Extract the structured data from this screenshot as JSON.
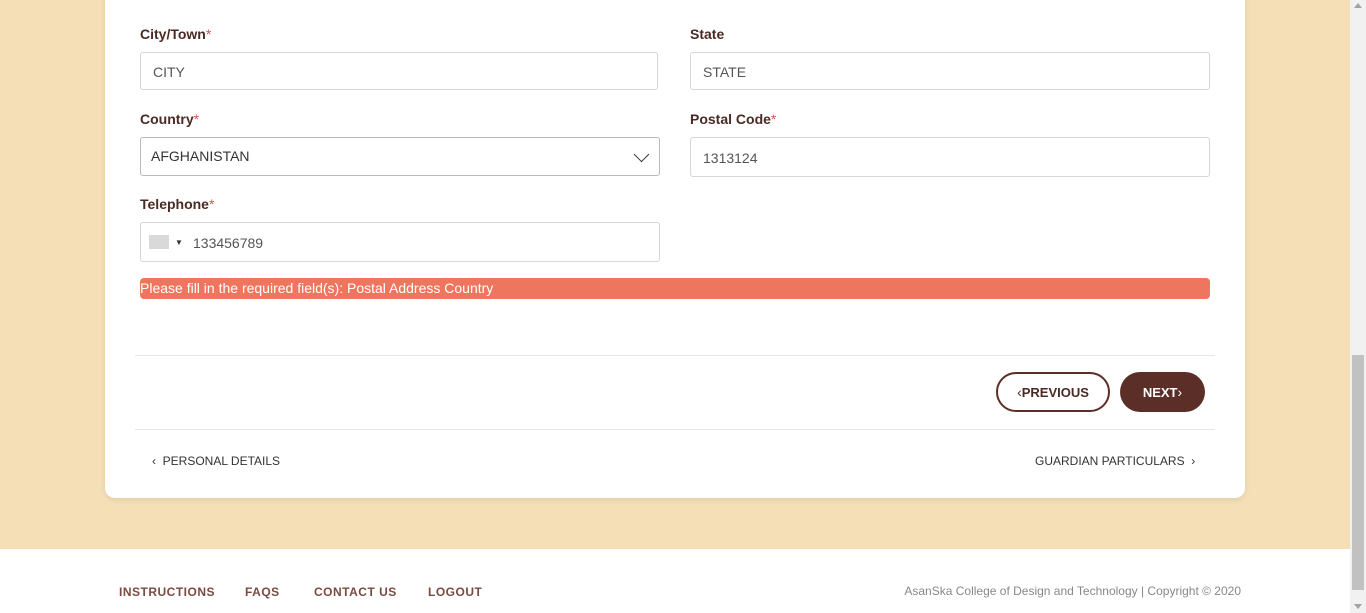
{
  "form": {
    "city": {
      "label": "City/Town",
      "required": "*",
      "placeholder": "CITY"
    },
    "state": {
      "label": "State",
      "placeholder": "STATE"
    },
    "country": {
      "label": "Country",
      "required": "*",
      "value": "AFGHANISTAN"
    },
    "postal": {
      "label": "Postal Code",
      "required": "*",
      "value": "1313124"
    },
    "telephone": {
      "label": "Telephone",
      "required": "*",
      "value": "133456789"
    },
    "error": "Please fill in the required field(s): Postal Address Country"
  },
  "buttons": {
    "previous": "PREVIOUS",
    "next": "NEXT"
  },
  "steps": {
    "prev": "PERSONAL DETAILS",
    "next": "GUARDIAN PARTICULARS"
  },
  "footer": {
    "links": [
      "INSTRUCTIONS",
      "FAQS",
      "CONTACT US",
      "LOGOUT"
    ],
    "copyright": "AsanSka College of Design and Technology | Copyright © 2020"
  },
  "colors": {
    "brand": "#5b2f28",
    "error": "#ef765e",
    "background": "#f4dfb6"
  },
  "icons": [
    "chevron-down-icon",
    "chevron-left-icon",
    "chevron-right-icon",
    "flag-icon"
  ]
}
